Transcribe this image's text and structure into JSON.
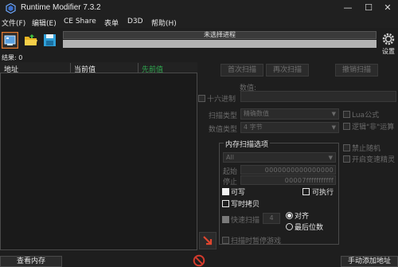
{
  "window": {
    "title": "Runtime Modifier 7.3.2",
    "minimize": "—",
    "maximize": "☐",
    "close": "✕"
  },
  "menu": {
    "items": [
      "文件(F)",
      "编辑(E)",
      "CE Share",
      "表单",
      "D3D",
      "帮助(H)"
    ]
  },
  "toolbar": {
    "process_label": "未选择进程",
    "progress": 0,
    "settings_label": "设置"
  },
  "found": {
    "label": "结果: 0"
  },
  "results": {
    "columns": [
      "地址",
      "当前值",
      "先前值"
    ]
  },
  "scan": {
    "first_scan": "首次扫描",
    "next_scan": "再次扫描",
    "undo_scan": "撤销扫描",
    "value_label": "数值:",
    "hex_label": "十六进制",
    "scan_type_label": "扫描类型",
    "scan_type_value": "精确数值",
    "value_type_label": "数值类型",
    "value_type_value": "4 字节",
    "lua_label": "Lua公式",
    "not_label": "逻辑\"非\"运算"
  },
  "memory": {
    "title": "内存扫描选项",
    "region": "All",
    "start_label": "起始",
    "start_value": "0000000000000000",
    "stop_label": "停止",
    "stop_value": "00007fffffffffff",
    "writable": "可写",
    "executable": "可执行",
    "copy_on_write": "写时拷贝",
    "fast_scan": "快速扫描",
    "fast_scan_value": "4",
    "align": "对齐",
    "last_digits": "最后位数",
    "pause_game": "扫描时暂停游戏",
    "no_random": "禁止随机",
    "speedhack": "开启变速精灵"
  },
  "bottom": {
    "view_memory": "查看内存",
    "add_address": "手动添加地址"
  },
  "colors": {
    "accent_orange": "#e2792e",
    "progress_green": "#6fcf6f",
    "prev_value_green": "#2fa84f",
    "stop_red": "#d33a2c"
  }
}
